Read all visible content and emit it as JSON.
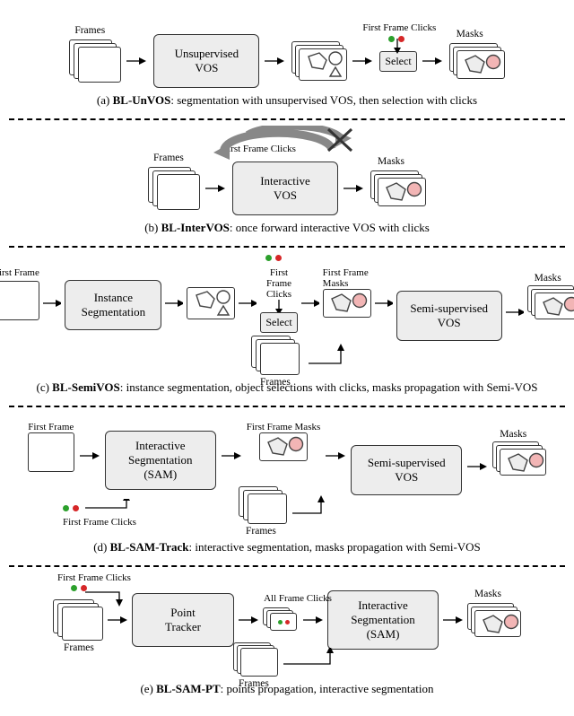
{
  "labels": {
    "frames": "Frames",
    "first_frame": "First Frame",
    "first_frame_clicks": "First Frame Clicks",
    "first_frame_masks": "First Frame Masks",
    "all_frame_clicks": "All Frame Clicks",
    "masks": "Masks",
    "select": "Select"
  },
  "blocks": {
    "unvos": "Unsupervised\nVOS",
    "intervos": "Interactive\nVOS",
    "instseg": "Instance\nSegmentation",
    "semivos": "Semi-supervised\nVOS",
    "intseg_sam": "Interactive\nSegmentation\n(SAM)",
    "point_tracker": "Point\nTracker"
  },
  "captions": {
    "a_b": "BL-UnVOS",
    "a_t": ": segmentation with unsupervised VOS, then selection with clicks",
    "b_b": "BL-InterVOS",
    "b_t": ": once forward interactive VOS with clicks",
    "c_b": "BL-SemiVOS",
    "c_t": ": instance segmentation, object selections with clicks, masks propagation with Semi-VOS",
    "d_b": "BL-SAM-Track",
    "d_t": ": interactive segmentation, masks propagation with Semi-VOS",
    "e_b": "BL-SAM-PT",
    "e_t": ": points propagation, interactive segmentation"
  }
}
